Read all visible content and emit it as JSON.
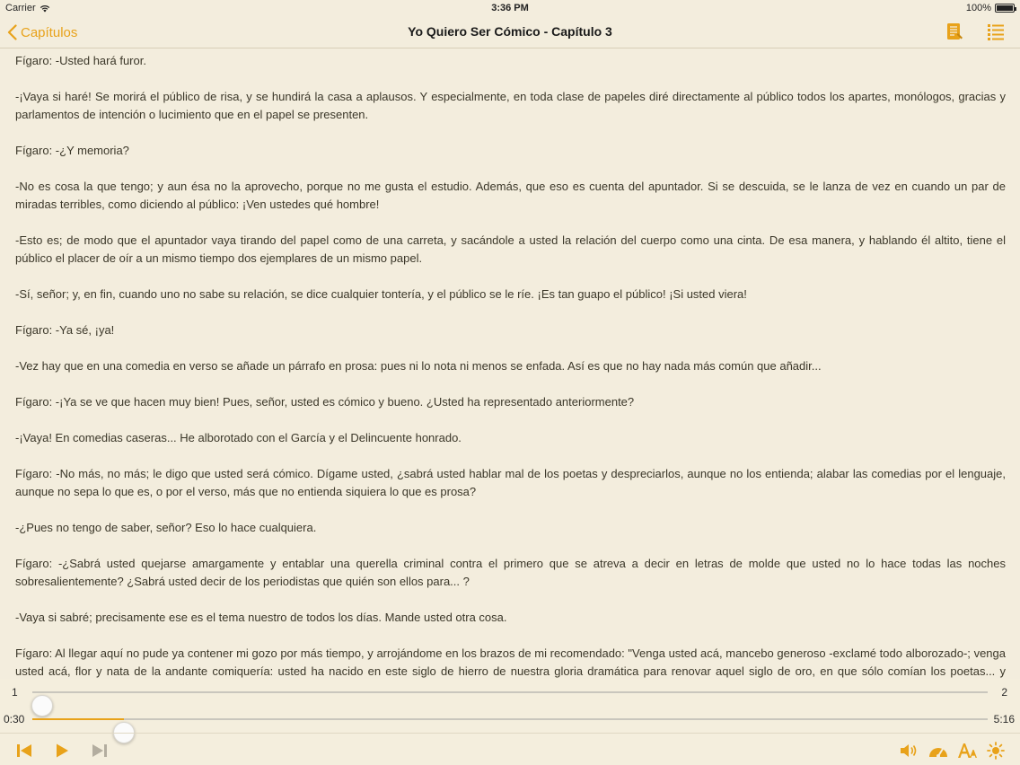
{
  "status": {
    "carrier": "Carrier",
    "time": "3:36 PM",
    "battery": "100%",
    "battery_level": 1.0
  },
  "nav": {
    "back_label": "Capítulos",
    "title": "Yo Quiero Ser Cómico - Capítulo 3"
  },
  "paragraphs": [
    "Fígaro: -Usted hará furor.",
    "-¡Vaya si haré! Se morirá el público de risa, y se hundirá la casa a aplausos. Y especialmente, en toda clase de papeles diré directamente al público todos los apartes, monólogos, gracias y parlamentos de intención o lucimiento que en el papel se presenten.",
    "Fígaro: -¿Y memoria?",
    "-No es cosa la que tengo; y aun ésa no la aprovecho, porque no me gusta el estudio. Además, que eso es cuenta del apuntador. Si se descuida, se le lanza de vez en cuando un par de miradas terribles, como diciendo al público: ¡Ven ustedes qué hombre!",
    "-Esto es; de modo que el apuntador vaya tirando del papel como de una carreta, y sacándole a usted la relación del cuerpo como una cinta. De esa manera, y hablando él altito, tiene el público el placer de oír a un mismo tiempo dos ejemplares de un mismo papel.",
    "-Sí, señor; y, en fin, cuando uno no sabe su relación, se dice cualquier tontería, y el público se le ríe. ¡Es tan guapo el público! ¡Si usted viera!",
    "Fígaro: -Ya sé, ¡ya!",
    "-Vez hay que en una comedia en verso se añade un párrafo en prosa: pues ni lo nota ni menos se enfada. Así es que no hay nada más común que añadir...",
    "Fígaro: -¡Ya se ve que hacen muy bien! Pues, señor, usted es cómico y bueno. ¿Usted ha representado anteriormente?",
    "-¡Vaya! En comedias caseras... He alborotado con el García y el Delincuente honrado.",
    "Fígaro: -No más, no más; le digo que usted será cómico. Dígame usted, ¿sabrá usted hablar mal de los poetas y despreciarlos, aunque no los entienda; alabar las comedias por el lenguaje, aunque no sepa lo que es, o por el verso, más que no entienda siquiera lo que es prosa?",
    "-¿Pues no tengo de saber, señor? Eso lo hace cualquiera.",
    "Fígaro: -¿Sabrá usted quejarse amargamente y entablar una querella criminal contra el primero que se atreva a decir en letras de molde que usted no lo hace todas las noches sobresalientemente? ¿Sabrá usted decir de los periodistas que quién son ellos para... ?",
    "-Vaya si sabré; precisamente ese es el tema nuestro de todos los días. Mande usted otra cosa.",
    "Fígaro: Al llegar aquí no pude ya contener mi gozo por más tiempo, y arrojándome en los brazos de mi recomendado: \"Venga usted acá, mancebo generoso -exclamé todo alborozado-; venga usted acá, flor y nata de la andante comiquería: usted ha nacido en este siglo de hierro de nuestra gloria dramática para renovar aquel siglo de oro, en que sólo comían los poetas... y pacientemente libertad por sus hazañas, sin el más leve recelo ni desaliento. Usted será cómico, sin duda, y volverán las comedias a tener sus buenos tiempos.\" Y con estas razones, despedí a mi candidato prometiéndole las más eficaces recomendaciones."
  ],
  "player": {
    "page_current": "1",
    "page_total": "2",
    "page_fraction": 0.01,
    "time_elapsed": "0:30",
    "time_total": "5:16",
    "time_fraction": 0.096
  },
  "icons": {
    "accent": "#e8a21a",
    "muted": "#b3ad9f",
    "nav": [
      "notes-icon",
      "chapter-list-icon"
    ],
    "toolbar_left": [
      "skip-back-icon",
      "play-icon",
      "skip-forward-icon"
    ],
    "toolbar_right": [
      "volume-icon",
      "speed-gauge-icon",
      "font-size-icon",
      "brightness-icon"
    ]
  }
}
